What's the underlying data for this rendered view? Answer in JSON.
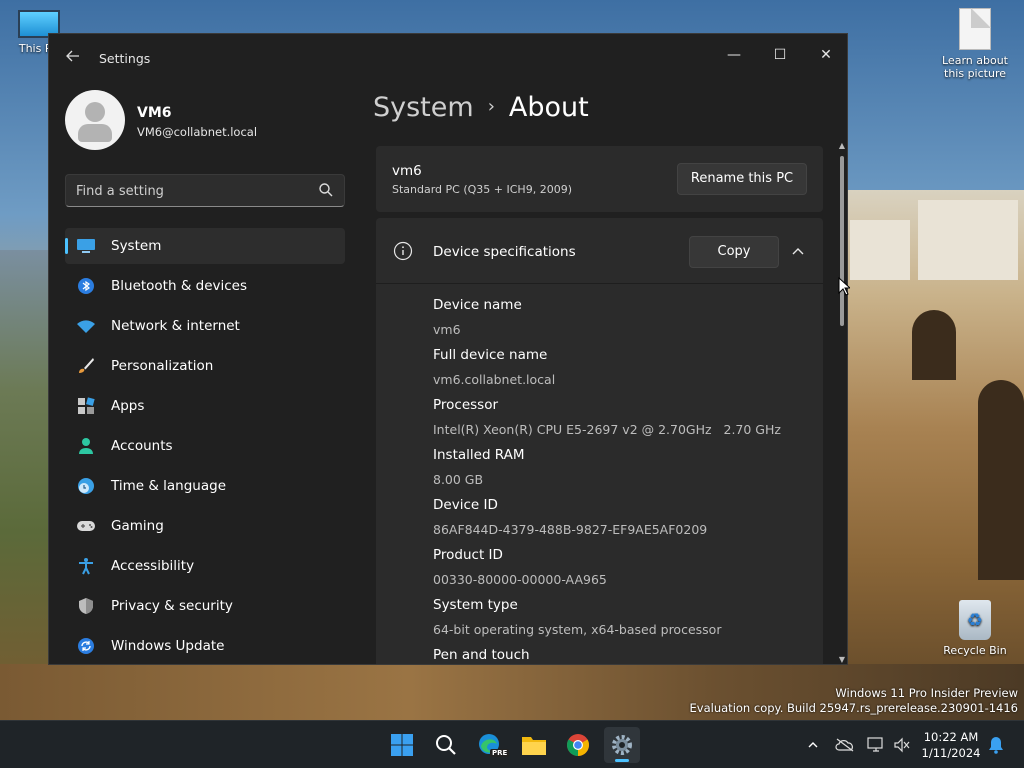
{
  "desktop": {
    "icons": {
      "this_pc": "This PC",
      "learn_picture": "Learn about this picture",
      "recycle_bin": "Recycle Bin"
    },
    "watermark": {
      "line1": "Windows 11 Pro Insider Preview",
      "line2": "Evaluation copy. Build 25947.rs_prerelease.230901-1416"
    }
  },
  "window": {
    "app_title": "Settings",
    "controls": {
      "minimize": "—",
      "maximize": "☐",
      "close": "✕"
    }
  },
  "user": {
    "name": "VM6",
    "email": "VM6@collabnet.local"
  },
  "search": {
    "placeholder": "Find a setting"
  },
  "sidebar": {
    "items": [
      {
        "label": "System",
        "icon": "system-icon",
        "active": true
      },
      {
        "label": "Bluetooth & devices",
        "icon": "bluetooth-icon"
      },
      {
        "label": "Network & internet",
        "icon": "wifi-icon"
      },
      {
        "label": "Personalization",
        "icon": "brush-icon"
      },
      {
        "label": "Apps",
        "icon": "apps-icon"
      },
      {
        "label": "Accounts",
        "icon": "person-icon"
      },
      {
        "label": "Time & language",
        "icon": "globe-clock-icon"
      },
      {
        "label": "Gaming",
        "icon": "gamepad-icon"
      },
      {
        "label": "Accessibility",
        "icon": "accessibility-icon"
      },
      {
        "label": "Privacy & security",
        "icon": "shield-icon"
      },
      {
        "label": "Windows Update",
        "icon": "update-icon"
      }
    ]
  },
  "breadcrumb": {
    "parent": "System",
    "separator": "›",
    "current": "About"
  },
  "pc_card": {
    "name": "vm6",
    "model": "Standard PC (Q35 + ICH9, 2009)",
    "rename_label": "Rename this PC"
  },
  "device_specs": {
    "title": "Device specifications",
    "copy_label": "Copy",
    "rows": [
      {
        "label": "Device name",
        "value": "vm6"
      },
      {
        "label": "Full device name",
        "value": "vm6.collabnet.local"
      },
      {
        "label": "Processor",
        "value": "Intel(R) Xeon(R) CPU E5-2697 v2 @ 2.70GHz   2.70 GHz"
      },
      {
        "label": "Installed RAM",
        "value": "8.00 GB"
      },
      {
        "label": "Device ID",
        "value": "86AF844D-4379-488B-9827-EF9AE5AF0209"
      },
      {
        "label": "Product ID",
        "value": "00330-80000-00000-AA965"
      },
      {
        "label": "System type",
        "value": "64-bit operating system, x64-based processor"
      },
      {
        "label": "Pen and touch",
        "value": ""
      }
    ]
  },
  "taskbar": {
    "clock_time": "10:22 AM",
    "clock_date": "1/11/2024",
    "edge_badge": "PRE"
  },
  "colors": {
    "accent": "#4cc2ff",
    "window_bg": "#202020",
    "card_bg": "#2b2b2b"
  }
}
